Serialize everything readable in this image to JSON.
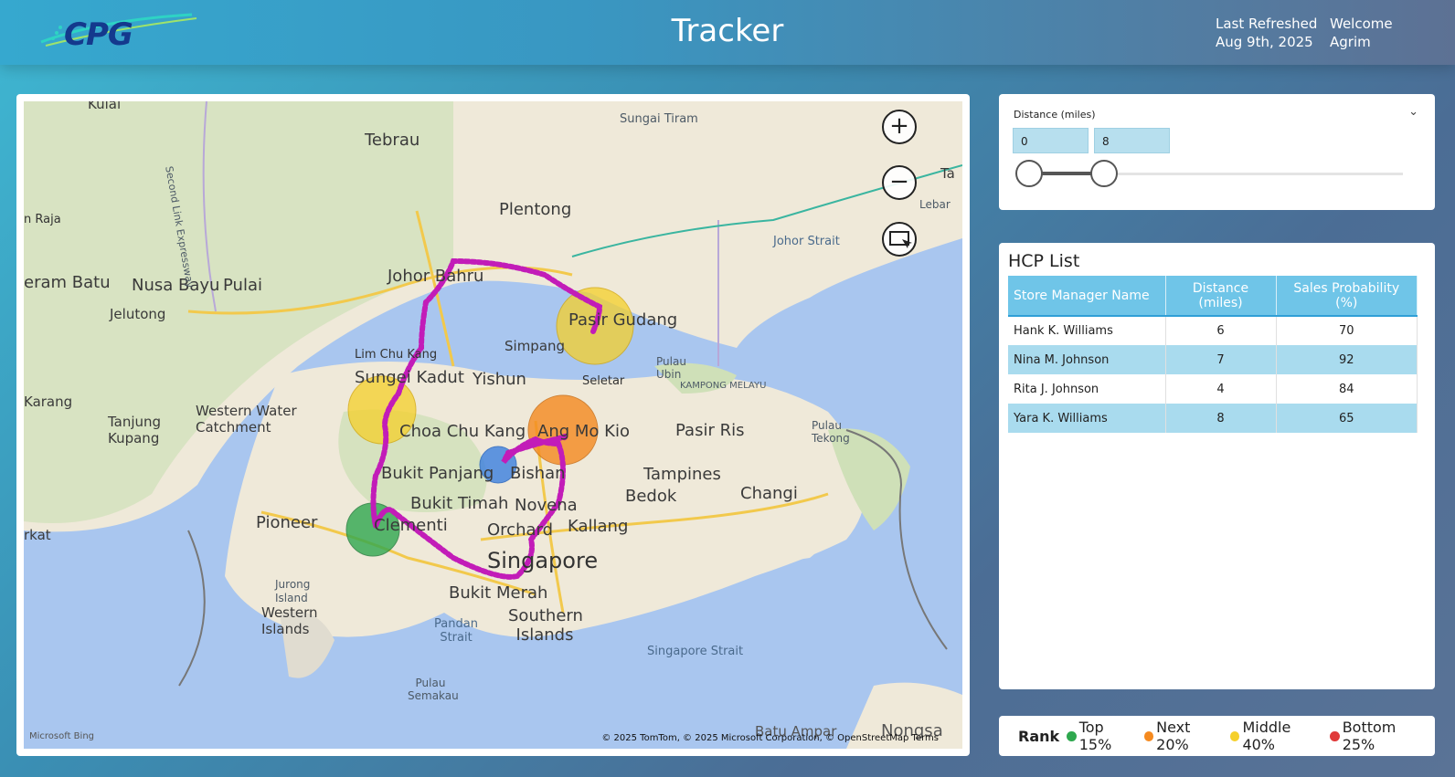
{
  "header": {
    "logo_text": "CPG",
    "title": "Tracker",
    "last_refreshed_label": "Last Refreshed",
    "last_refreshed_value": "Aug 9th, 2025",
    "welcome_label": "Welcome",
    "user_name": "Agrim"
  },
  "map": {
    "labels": {
      "kulai": "Kulai",
      "sungai_tiram": "Sungai Tiram",
      "tebrau": "Tebrau",
      "plentong": "Plentong",
      "n_raja": "n Raja",
      "second_link": "Second Link Expressway",
      "eram_batu": "eram Batu",
      "nusa_bayu": "Nusa Bayu",
      "pulai": "Pulai",
      "johor_bahru": "Johor Bahru",
      "jelutong": "Jelutong",
      "johor_strait": "Johor Strait",
      "pasir_gudang": "Pasir Gudang",
      "lim_chu_kang": "Lim Chu Kang",
      "simpang": "Simpang",
      "sungei_kadut": "Sungei Kadut",
      "yishun": "Yishun",
      "seletar": "Seletar",
      "pulau_ubin": "Pulau Ubin",
      "kampong_melayu": "KAMPONG MELAYU",
      "karang": "Karang",
      "western_catchment": "Western Water Catchment",
      "tanjung_kupang": "Tanjung Kupang",
      "choa_chu_kang": "Choa Chu Kang",
      "ang_mo_kio": "Ang Mo Kio",
      "pasir_ris": "Pasir Ris",
      "pulau_tekong": "Pulau Tekong",
      "bukit_panjang": "Bukit Panjang",
      "bishan": "Bishan",
      "tampines": "Tampines",
      "bedok": "Bedok",
      "changi": "Changi",
      "bukit_timah": "Bukit Timah",
      "novena": "Novena",
      "pioneer": "Pioneer",
      "clementi": "Clementi",
      "orchard": "Orchard",
      "kallang": "Kallang",
      "rkat": "rkat",
      "singapore": "Singapore",
      "jurong_island": "Jurong Island",
      "western_islands": "Western Islands",
      "bukit_merah": "Bukit Merah",
      "southern_islands": "Southern Islands",
      "pandan_strait": "Pandan Strait",
      "singapore_strait": "Singapore Strait",
      "pulau_semakau": "Pulau Semakau",
      "batu_ampar": "Batu Ampar",
      "nongsa": "Nongsa",
      "lebar": "Lebar",
      "ta": "Ta"
    },
    "bing_label": "Microsoft Bing",
    "copyright": "© 2025 TomTom, © 2025 Microsoft Corporation, © OpenStreetMap  Terms",
    "zoom_in": "+",
    "zoom_out": "−"
  },
  "slicer": {
    "title": "Distance (miles)",
    "min_value": "0",
    "max_value": "8",
    "range_fraction_high": 0.2
  },
  "hcp_list": {
    "title": "HCP List",
    "columns": [
      "Store Manager Name",
      "Distance (miles)",
      "Sales Probability (%)"
    ],
    "rows": [
      {
        "name": "Hank K. Williams",
        "distance": "6",
        "probability": "70"
      },
      {
        "name": "Nina M. Johnson",
        "distance": "7",
        "probability": "92"
      },
      {
        "name": "Rita J. Johnson",
        "distance": "4",
        "probability": "84"
      },
      {
        "name": "Yara K. Williams",
        "distance": "8",
        "probability": "65"
      }
    ]
  },
  "legend": {
    "title": "Rank",
    "items": [
      {
        "label": "Top 15%",
        "color": "#2fa84f"
      },
      {
        "label": "Next 20%",
        "color": "#f58a1f"
      },
      {
        "label": "Middle 40%",
        "color": "#f5d02a"
      },
      {
        "label": "Bottom 25%",
        "color": "#e03a3a"
      }
    ]
  },
  "colors": {
    "route": "#c21cb8",
    "bubble_green": "#2fa84f",
    "bubble_orange": "#f58a1f",
    "bubble_yellow": "#f5d02a",
    "bubble_blue": "#3a7fe0"
  }
}
